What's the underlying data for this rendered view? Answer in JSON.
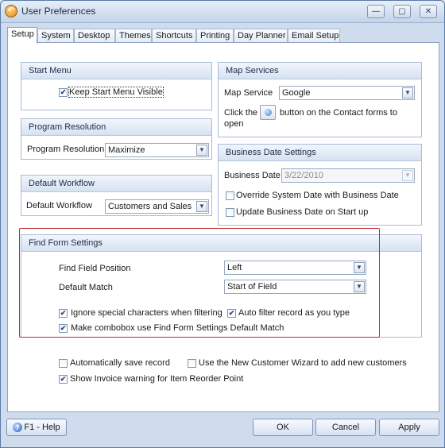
{
  "window": {
    "title": "User Preferences",
    "min_glyph": "—",
    "max_glyph": "▢",
    "close_glyph": "✕",
    "app_icon": "back-arrow-icon"
  },
  "tabs": [
    "Setup",
    "System",
    "Desktop",
    "Themes",
    "Shortcuts",
    "Printing",
    "Day Planner",
    "Email Setup"
  ],
  "start_menu": {
    "title": "Start Menu",
    "keep_visible_label": "Keep Start Menu Visible",
    "keep_visible": true
  },
  "program_resolution": {
    "title": "Program Resolution",
    "label": "Program Resolution",
    "value": "Maximize"
  },
  "default_workflow": {
    "title": "Default Workflow",
    "label": "Default Workflow",
    "value": "Customers and Sales"
  },
  "map_services": {
    "title": "Map Services",
    "label": "Map Service",
    "value": "Google",
    "hint_before": "Click the",
    "hint_after": "button on the Contact forms to",
    "hint_end": "open"
  },
  "business_date": {
    "title": "Business Date Settings",
    "label": "Business Date",
    "value": "3/22/2010",
    "override_label": "Override System Date with Business Date",
    "override": false,
    "update_label": "Update Business Date on Start up",
    "update": false
  },
  "find_form": {
    "title": "Find Form Settings",
    "field_position_label": "Find Field Position",
    "field_position": "Left",
    "default_match_label": "Default Match",
    "default_match": "Start of Field",
    "ignore_special_label": "Ignore special characters when filtering",
    "ignore_special": true,
    "auto_filter_label": "Auto filter record as you type",
    "auto_filter": true,
    "combobox_label": "Make combobox use Find Form Settings Default Match",
    "combobox": true
  },
  "misc": {
    "autosave_label": "Automatically save record",
    "autosave": false,
    "wizard_label": "Use the New Customer Wizard to add new customers",
    "wizard": false,
    "reorder_label": "Show Invoice warning for Item Reorder Point",
    "reorder": true
  },
  "buttons": {
    "help": "F1 - Help",
    "ok": "OK",
    "cancel": "Cancel",
    "apply": "Apply"
  },
  "colors": {
    "highlight_border": "#c0282d",
    "accent": "#2e62b6"
  }
}
